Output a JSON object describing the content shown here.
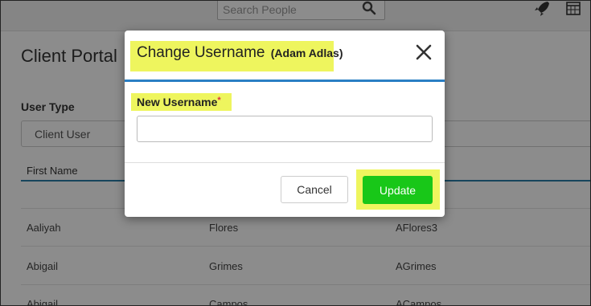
{
  "header": {
    "search_placeholder": "Search People",
    "icons": [
      "search-icon",
      "rocket-icon",
      "calendar-icon"
    ]
  },
  "page": {
    "title": "Client Portal",
    "user_type_label": "User Type",
    "user_type_value": "Client User"
  },
  "table": {
    "columns": [
      "First Name",
      "",
      ""
    ],
    "rows": [
      [
        "Aaliyah",
        "Flores",
        "AFlores3"
      ],
      [
        "Abigail",
        "Grimes",
        "AGrimes"
      ],
      [
        "Abigail",
        "Campos",
        "ACampos"
      ]
    ]
  },
  "modal": {
    "title": "Change Username",
    "subtitle": "(Adam Adlas)",
    "field_label": "New Username",
    "required_mark": "*",
    "input_value": "",
    "cancel_label": "Cancel",
    "update_label": "Update"
  },
  "colors": {
    "highlight": "#eef55e",
    "update_button": "#18c718",
    "accent_blue": "#2a7fc4",
    "required": "#d9363e"
  }
}
